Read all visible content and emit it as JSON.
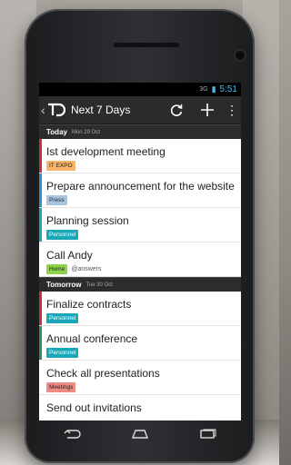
{
  "status": {
    "time": "5:51",
    "signal": "3G"
  },
  "actionbar": {
    "title": "Next 7 Days"
  },
  "sections": [
    {
      "label": "Today",
      "date": "Mon 29 Oct",
      "tasks": [
        {
          "title": "Ist development meeting",
          "bar": "#c5303a",
          "tags": [
            {
              "label": "IT EXPO",
              "kind": "expo"
            }
          ]
        },
        {
          "title": "Prepare announcement for the website",
          "bar": "#2e8fc8",
          "tags": [
            {
              "label": "Press",
              "kind": "press"
            }
          ]
        },
        {
          "title": "Planning session",
          "bar": "#1aa7b8",
          "tags": [
            {
              "label": "Personnel",
              "kind": "personnel"
            }
          ]
        },
        {
          "title": "Call Andy",
          "bar": "#ffffff",
          "tags": [
            {
              "label": "Home",
              "kind": "home"
            }
          ],
          "mention": "@answers"
        }
      ]
    },
    {
      "label": "Tomorrow",
      "date": "Tue 30 Oct",
      "tasks": [
        {
          "title": "Finalize contracts",
          "bar": "#c5303a",
          "tags": [
            {
              "label": "Personnel",
              "kind": "personnel"
            }
          ]
        },
        {
          "title": "Annual conference",
          "bar": "#2e8f58",
          "tags": [
            {
              "label": "Personnel",
              "kind": "personnel"
            }
          ]
        },
        {
          "title": "Check all presentations",
          "bar": "#ffffff",
          "tags": [
            {
              "label": "Meetings",
              "kind": "meetings"
            }
          ]
        },
        {
          "title": "Send out invitations",
          "bar": "#ffffff",
          "tags": []
        }
      ]
    }
  ],
  "icons": {
    "refresh": "refresh-icon",
    "add": "plus-icon",
    "overflow": "overflow-menu-icon",
    "back": "back-icon",
    "home": "home-icon",
    "recents": "recent-apps-icon"
  }
}
